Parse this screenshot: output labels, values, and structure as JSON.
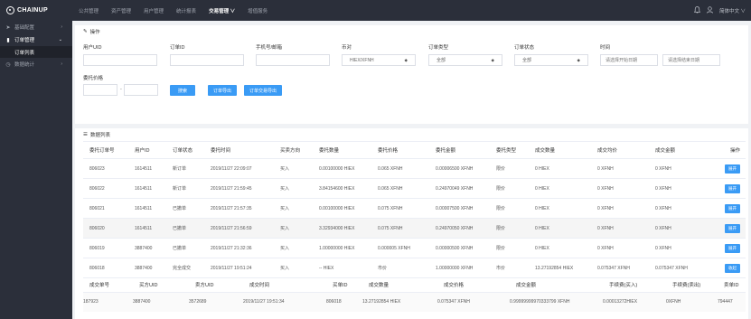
{
  "brand": {
    "name": "CHAINUP"
  },
  "topnav": [
    {
      "label": "公共管理",
      "active": false
    },
    {
      "label": "资产管理",
      "active": false
    },
    {
      "label": "用户管理",
      "active": false
    },
    {
      "label": "统计报表",
      "active": false
    },
    {
      "label": "交易管理 ∨",
      "active": true
    },
    {
      "label": "增值服务",
      "active": false
    }
  ],
  "topright": {
    "language": "简体中文 ∨"
  },
  "sidebar": {
    "items": [
      {
        "label": "基础配置",
        "icon": "send-icon"
      },
      {
        "label": "订单管理",
        "icon": "chart-icon",
        "open": true
      },
      {
        "label": "数据统计",
        "icon": "clock-icon"
      }
    ],
    "sub_active": "订单列表"
  },
  "filters": {
    "title": "操作",
    "uid_label": "用户UID",
    "order_id_label": "订单ID",
    "phone_label": "手机号/邮箱",
    "pair_label": "币对",
    "pair_value": "HIEX/XFNH",
    "order_type_label": "订单类型",
    "order_type_value": "全部",
    "order_status_label": "订单状态",
    "order_status_value": "全部",
    "time_label": "时间",
    "start_placeholder": "请选择开始日期",
    "end_placeholder": "请选择结束日期",
    "price_label": "委托价格",
    "price_sep": "-",
    "search_btn": "搜索",
    "export_btn": "订单导出",
    "export_trades_btn": "订单交易导出"
  },
  "list": {
    "title": "数据列表",
    "columns": [
      "委托订单号",
      "用户ID",
      "订单状态",
      "委托时间",
      "买卖方向",
      "委托数量",
      "委托价格",
      "委托金额",
      "委托类型",
      "成交数量",
      "成交均价",
      "成交金额",
      "操作"
    ],
    "rows": [
      [
        "806023",
        "1614511",
        "新订单",
        "2019/11/27 22:09:07",
        "买入",
        "0.00100000 HIEX",
        "0.065 XFNH",
        "0.00006500 XFNH",
        "限价",
        "0 HIEX",
        "0 XFNH",
        "0 XFNH",
        "展开"
      ],
      [
        "806022",
        "1614511",
        "新订单",
        "2019/11/27 21:59:45",
        "买入",
        "3.84154600 HIEX",
        "0.065 XFNH",
        "0.24970049 XFNH",
        "限价",
        "0 HIEX",
        "0 XFNH",
        "0 XFNH",
        "展开"
      ],
      [
        "806021",
        "1614511",
        "已撤单",
        "2019/11/27 21:57:35",
        "买入",
        "0.00100000 HIEX",
        "0.075 XFNH",
        "0.00007500 XFNH",
        "限价",
        "0 HIEX",
        "0 XFNH",
        "0 XFNH",
        "展开"
      ],
      [
        "806020",
        "1614511",
        "已撤单",
        "2019/11/27 21:56:59",
        "买入",
        "3.32934000 HIEX",
        "0.075 XFNH",
        "0.24970050 XFNH",
        "限价",
        "0 HIEX",
        "0 XFNH",
        "0 XFNH",
        "展开"
      ],
      [
        "806019",
        "3887400",
        "已撤单",
        "2019/11/27 21:32:36",
        "买入",
        "1.00000000 HIEX",
        "0.000005 XFNH",
        "0.00000500 XFNH",
        "限价",
        "0 HIEX",
        "0 XFNH",
        "0 XFNH",
        "展开"
      ],
      [
        "806018",
        "3887400",
        "完全成交",
        "2019/11/27 19:51:24",
        "买入",
        "-- HIEX",
        "市价",
        "1.00000000 XFNH",
        "市价",
        "13.27192854 HIEX",
        "0.075347 XFNH",
        "0.075347 XFNH",
        "收起"
      ]
    ],
    "detail_columns": [
      "成交单号",
      "买方UID",
      "卖方UID",
      "成交时间",
      "买单ID",
      "成交数量",
      "成交价格",
      "成交金额",
      "手续费(买入)",
      "手续费(卖出)",
      "卖单ID"
    ],
    "detail_rows": [
      [
        "187923",
        "3887400",
        "3572689",
        "2019/11/27 19:51:34",
        "806018",
        "13.27192854 HIEX",
        "0.075347 XFNH",
        "0.99999999970333799 XFNH",
        "0.00013272HIEX",
        "0XFNH",
        "794447"
      ]
    ]
  },
  "colors": {
    "sidebar": "#2b2f3a",
    "accent": "#3a9bf5",
    "background": "#f0f2f5"
  }
}
